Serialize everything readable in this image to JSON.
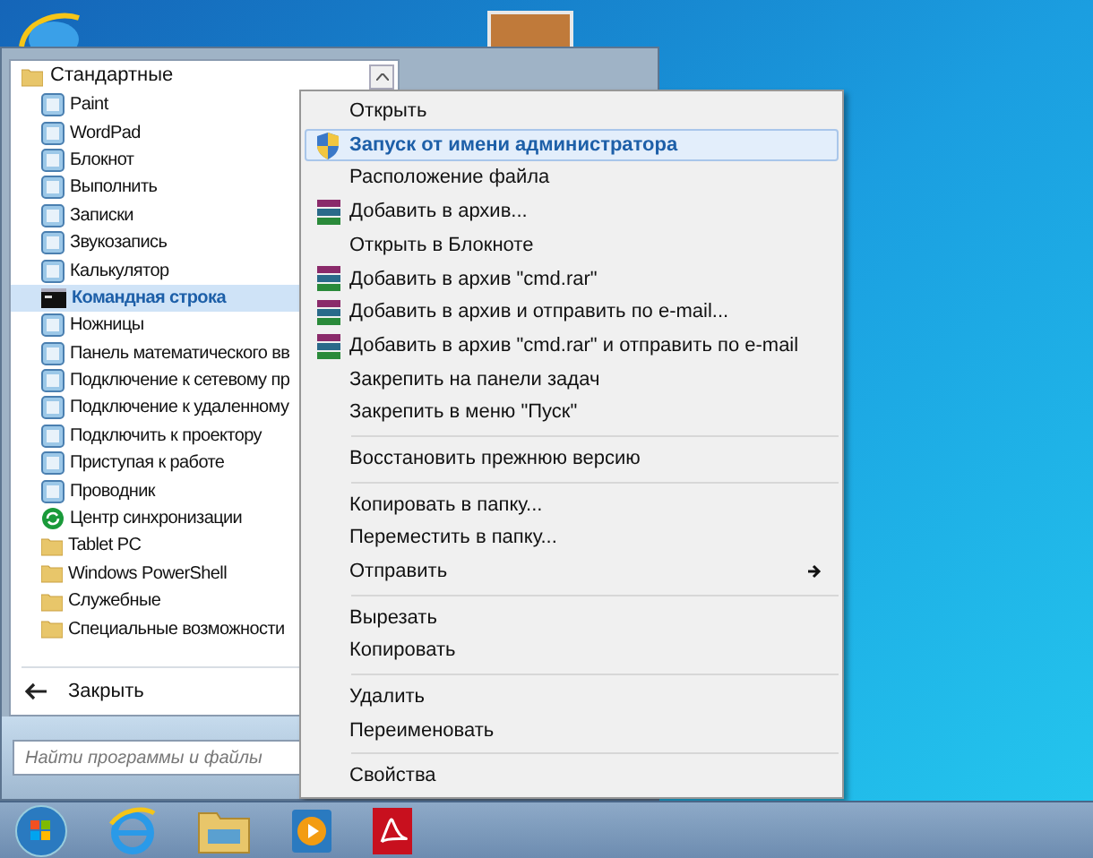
{
  "start_menu": {
    "header": {
      "label": "Стандартные",
      "expanded": true
    },
    "items": [
      {
        "label": "Paint",
        "kind": "app",
        "selected": false
      },
      {
        "label": "WordPad",
        "kind": "app",
        "selected": false
      },
      {
        "label": "Блокнот",
        "kind": "app",
        "selected": false
      },
      {
        "label": "Выполнить",
        "kind": "app",
        "selected": false
      },
      {
        "label": "Записки",
        "kind": "app",
        "selected": false
      },
      {
        "label": "Звукозапись",
        "kind": "app",
        "selected": false
      },
      {
        "label": "Калькулятор",
        "kind": "app",
        "selected": false
      },
      {
        "label": "Командная строка",
        "kind": "console",
        "selected": true
      },
      {
        "label": "Ножницы",
        "kind": "app",
        "selected": false
      },
      {
        "label": "Панель математического вв",
        "kind": "app",
        "selected": false
      },
      {
        "label": "Подключение к сетевому пр",
        "kind": "app",
        "selected": false
      },
      {
        "label": "Подключение к удаленному",
        "kind": "app",
        "selected": false
      },
      {
        "label": "Подключить к проектору",
        "kind": "app",
        "selected": false
      },
      {
        "label": "Приступая к работе",
        "kind": "app",
        "selected": false
      },
      {
        "label": "Проводник",
        "kind": "app",
        "selected": false
      },
      {
        "label": "Центр синхронизации",
        "kind": "sync",
        "selected": false
      },
      {
        "label": "Tablet PC",
        "kind": "folder",
        "selected": false
      },
      {
        "label": "Windows PowerShell",
        "kind": "folder",
        "selected": false
      },
      {
        "label": "Служебные",
        "kind": "folder",
        "selected": false
      },
      {
        "label": "Специальные возможности",
        "kind": "folder",
        "selected": false
      }
    ],
    "back_button": "Закрыть",
    "search": {
      "placeholder": "Найти программы и файлы"
    }
  },
  "context_menu": {
    "items": [
      {
        "kind": "item",
        "label": "Открыть",
        "selected": false
      },
      {
        "kind": "admin",
        "label": "Запуск от имени администратора",
        "selected": true
      },
      {
        "kind": "item",
        "label": "Расположение файла",
        "selected": false
      },
      {
        "kind": "archive",
        "label": "Добавить в архив...",
        "selected": false
      },
      {
        "kind": "item",
        "label": "Открыть в Блокноте",
        "selected": false
      },
      {
        "kind": "archive",
        "label": "Добавить в архив \"cmd.rar\"",
        "selected": false
      },
      {
        "kind": "archive",
        "label": "Добавить в архив и отправить по e-mail...",
        "selected": false
      },
      {
        "kind": "archive",
        "label": "Добавить в архив \"cmd.rar\" и отправить по e-mail",
        "selected": false
      },
      {
        "kind": "item",
        "label": "Закрепить на панели задач",
        "selected": false
      },
      {
        "kind": "item",
        "label": "Закрепить в меню \"Пуск\"",
        "selected": false
      },
      {
        "kind": "separator"
      },
      {
        "kind": "item",
        "label": "Восстановить прежнюю версию",
        "selected": false
      },
      {
        "kind": "separator"
      },
      {
        "kind": "item",
        "label": "Копировать в папку...",
        "selected": false
      },
      {
        "kind": "item",
        "label": "Переместить в папку...",
        "selected": false
      },
      {
        "kind": "submenu",
        "label": "Отправить",
        "selected": false
      },
      {
        "kind": "separator"
      },
      {
        "kind": "item",
        "label": "Вырезать",
        "selected": false
      },
      {
        "kind": "item",
        "label": "Копировать",
        "selected": false
      },
      {
        "kind": "separator"
      },
      {
        "kind": "item",
        "label": "Удалить",
        "selected": false
      },
      {
        "kind": "item",
        "label": "Переименовать",
        "selected": false
      },
      {
        "kind": "separator"
      },
      {
        "kind": "item",
        "label": "Свойства",
        "selected": false
      }
    ]
  }
}
